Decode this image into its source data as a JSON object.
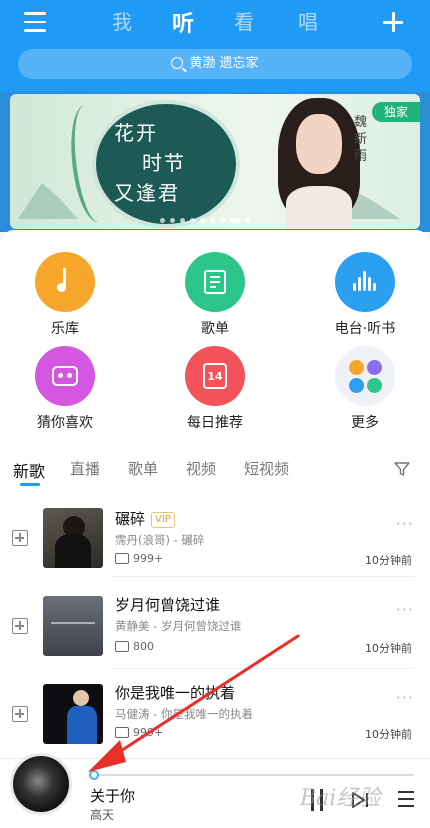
{
  "header": {
    "tabs": [
      {
        "label": "我"
      },
      {
        "label": "听"
      },
      {
        "label": "看"
      },
      {
        "label": "唱"
      }
    ],
    "active_tab": "听",
    "search_text": "黄渤  遗忘家"
  },
  "banner": {
    "title_line1": "花开",
    "title_line2": "时节",
    "title_line3": "又逢君",
    "artist": "魏新雨",
    "badge": "独家",
    "slide_count": 9,
    "active_slide": 7
  },
  "features": [
    {
      "label": "乐库",
      "icon": "music-note-icon",
      "color": "#f7a62c"
    },
    {
      "label": "歌单",
      "icon": "playlist-icon",
      "color": "#2cc58a"
    },
    {
      "label": "电台·听书",
      "icon": "sound-wave-icon",
      "color": "#2b9ff0"
    },
    {
      "label": "猜你喜欢",
      "icon": "radio-heart-icon",
      "color": "#d556e0"
    },
    {
      "label": "每日推荐",
      "icon": "calendar-icon",
      "color": "#f2535a",
      "day": "14"
    },
    {
      "label": "更多",
      "icon": "more-grid-icon",
      "color": "#eef1f5"
    }
  ],
  "content_tabs": [
    {
      "label": "新歌"
    },
    {
      "label": "直播"
    },
    {
      "label": "歌单"
    },
    {
      "label": "视频"
    },
    {
      "label": "短视频"
    }
  ],
  "songs": [
    {
      "title": "碾碎",
      "vip": "VIP",
      "subtitle": "霈丹(浪哥) - 碾碎",
      "comments": "999+",
      "time": "10分钟前"
    },
    {
      "title": "岁月何曾饶过谁",
      "subtitle": "黄静美 - 岁月何曾饶过谁",
      "comments": "800",
      "time": "10分钟前"
    },
    {
      "title": "你是我唯一的执着",
      "subtitle": "马健涛 - 你是我唯一的执着",
      "comments": "999+",
      "time": "10分钟前"
    }
  ],
  "now_playing": {
    "title": "关于你",
    "artist": "高天",
    "progress": 0.0
  },
  "watermark": "Bai经验",
  "colors": {
    "header_blue": "#1f9af5",
    "accent": "#1f9af5",
    "arrow_red": "#e8302a"
  }
}
